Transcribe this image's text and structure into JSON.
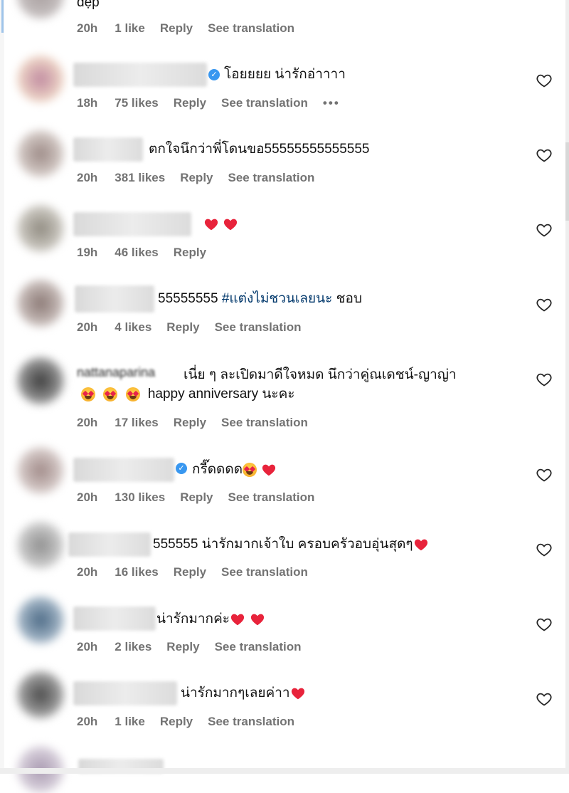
{
  "colors": {
    "meta": "#737373",
    "heart": "#e8233b",
    "verified": "#3897f0",
    "hashtag": "#00376b"
  },
  "top_partial": {
    "text": "đẹp",
    "time": "20h",
    "likes": "1 like",
    "reply": "Reply",
    "translate": "See translation"
  },
  "comments": [
    {
      "text": "โอยยยย น่ารักอ่าาาา",
      "time": "18h",
      "likes": "75 likes",
      "reply": "Reply",
      "translate": "See translation",
      "more": "•••"
    },
    {
      "text": "ตกใจนึกว่าพี่โดนขอ55555555555555",
      "time": "20h",
      "likes": "381 likes",
      "reply": "Reply",
      "translate": "See translation"
    },
    {
      "text": "",
      "time": "19h",
      "likes": "46 likes",
      "reply": "Reply"
    },
    {
      "text_plain": "55555555 ",
      "hashtag": "#แต่งไม่ชวนเลยนะ",
      "text_tail": " ชอบ",
      "time": "20h",
      "likes": "4 likes",
      "reply": "Reply",
      "translate": "See translation"
    },
    {
      "name_partial": "nattanaparina",
      "line1": "เนี่ย ๆ ละเปิดมาดีใจหมด นึกว่าคู่ณเดชน์-ญาญ่า",
      "line2": "happy anniversary นะคะ",
      "time": "20h",
      "likes": "17 likes",
      "reply": "Reply",
      "translate": "See translation"
    },
    {
      "text": "กรี๊ดดดด",
      "time": "20h",
      "likes": "130 likes",
      "reply": "Reply",
      "translate": "See translation"
    },
    {
      "text": "555555 น่ารักมากเจ้าใบ ครอบครัวอบอุ่นสุดๆ",
      "time": "20h",
      "likes": "16 likes",
      "reply": "Reply",
      "translate": "See translation"
    },
    {
      "text": "น่ารักมากค่ะ",
      "time": "20h",
      "likes": "2 likes",
      "reply": "Reply",
      "translate": "See translation"
    },
    {
      "text": "น่ารักมากๆเลยค่าา",
      "time": "20h",
      "likes": "1 like",
      "reply": "Reply",
      "translate": "See translation"
    }
  ],
  "icons": {
    "like": "heart-outline-icon",
    "verified": "verified-badge-icon"
  }
}
